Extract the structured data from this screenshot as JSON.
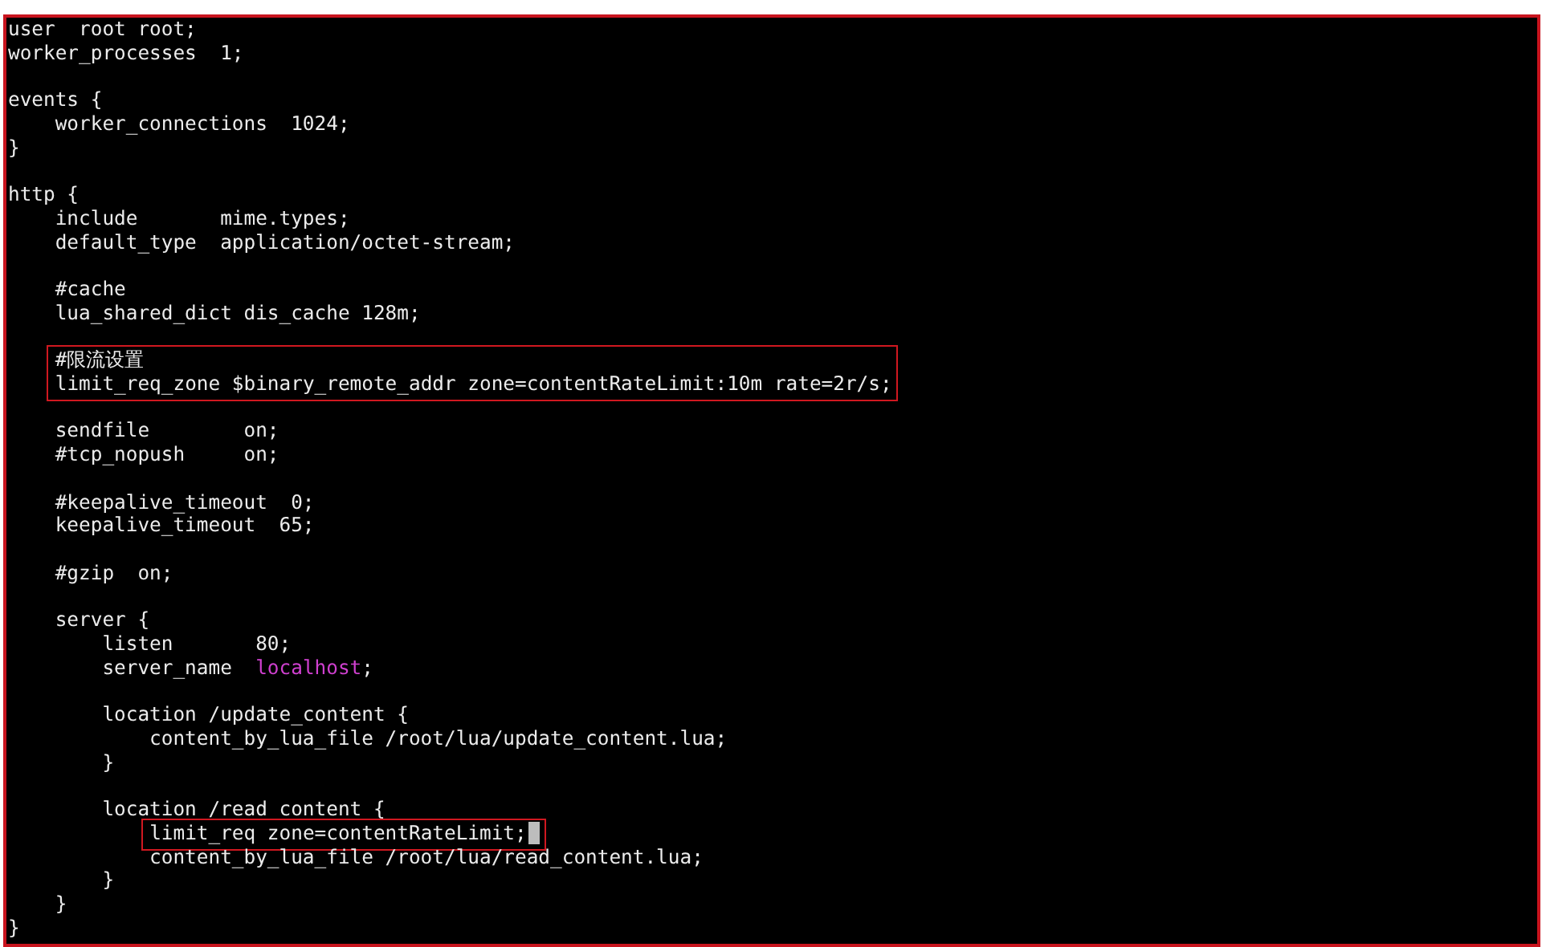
{
  "terminal": {
    "lines": [
      {
        "kind": "text",
        "text": "user  root root;"
      },
      {
        "kind": "text",
        "text": "worker_processes  1;"
      },
      {
        "kind": "blank"
      },
      {
        "kind": "text",
        "text": "events {"
      },
      {
        "kind": "text",
        "text": "    worker_connections  1024;"
      },
      {
        "kind": "text",
        "text": "}"
      },
      {
        "kind": "blank"
      },
      {
        "kind": "text",
        "text": "http {"
      },
      {
        "kind": "text",
        "text": "    include       mime.types;"
      },
      {
        "kind": "text",
        "text": "    default_type  application/octet-stream;"
      },
      {
        "kind": "blank"
      },
      {
        "kind": "text",
        "text": "    #cache"
      },
      {
        "kind": "text",
        "text": "    lua_shared_dict dis_cache 128m;"
      },
      {
        "kind": "blank"
      },
      {
        "kind": "highlight",
        "lines": [
          {
            "text": "    #限流设置",
            "cursor": false
          },
          {
            "text": "    limit_req_zone $binary_remote_addr zone=contentRateLimit:10m rate=2r/s;",
            "cursor": false
          }
        ]
      },
      {
        "kind": "blank"
      },
      {
        "kind": "text",
        "text": "    sendfile        on;"
      },
      {
        "kind": "text",
        "text": "    #tcp_nopush     on;"
      },
      {
        "kind": "blank"
      },
      {
        "kind": "text",
        "text": "    #keepalive_timeout  0;"
      },
      {
        "kind": "text",
        "text": "    keepalive_timeout  65;"
      },
      {
        "kind": "blank"
      },
      {
        "kind": "text",
        "text": "    #gzip  on;"
      },
      {
        "kind": "blank"
      },
      {
        "kind": "text",
        "text": "    server {"
      },
      {
        "kind": "text",
        "text": "        listen       80;"
      },
      {
        "kind": "colored",
        "spans": [
          {
            "kind": "plain",
            "text": "        server_name  "
          },
          {
            "kind": "value",
            "text": "localhost"
          },
          {
            "kind": "plain",
            "text": ";"
          }
        ]
      },
      {
        "kind": "blank"
      },
      {
        "kind": "text",
        "text": "        location /update_content {"
      },
      {
        "kind": "text",
        "text": "            content_by_lua_file /root/lua/update_content.lua;"
      },
      {
        "kind": "text",
        "text": "        }"
      },
      {
        "kind": "blank"
      },
      {
        "kind": "text",
        "text": "        location /read_content {"
      },
      {
        "kind": "highlight",
        "lines": [
          {
            "text": "            limit_req zone=contentRateLimit;",
            "cursor": true
          }
        ]
      },
      {
        "kind": "text",
        "text": "            content_by_lua_file /root/lua/read_content.lua;"
      },
      {
        "kind": "text",
        "text": "        }"
      },
      {
        "kind": "text",
        "text": "    }"
      },
      {
        "kind": "text",
        "text": "}"
      }
    ]
  }
}
